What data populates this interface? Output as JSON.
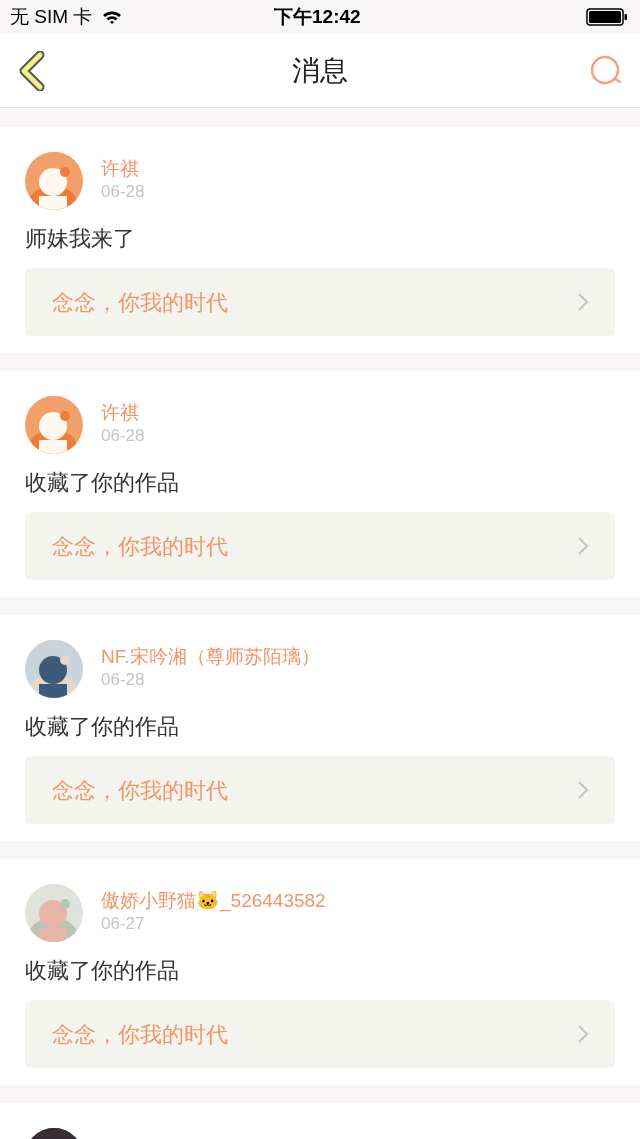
{
  "status_bar": {
    "carrier": "无 SIM 卡",
    "time": "下午12:42"
  },
  "nav": {
    "title": "消息"
  },
  "messages": [
    {
      "name": "许祺",
      "date": "06-28",
      "text": "师妹我来了",
      "work": "念念，你我的时代",
      "avatar": {
        "kind": "picture"
      }
    },
    {
      "name": "许祺",
      "date": "06-28",
      "text": "收藏了你的作品",
      "work": "念念，你我的时代",
      "avatar": {
        "kind": "picture"
      }
    },
    {
      "name": "NF.宋吟湘（尊师苏陌璃）",
      "date": "06-28",
      "text": "收藏了你的作品",
      "work": "念念，你我的时代",
      "avatar": {
        "kind": "picture"
      }
    },
    {
      "name": "傲娇小野猫🐱_526443582",
      "date": "06-27",
      "text": "收藏了你的作品",
      "work": "念念，你我的时代",
      "avatar": {
        "kind": "picture"
      }
    },
    {
      "avatar": {
        "kind": "picture"
      }
    }
  ]
}
